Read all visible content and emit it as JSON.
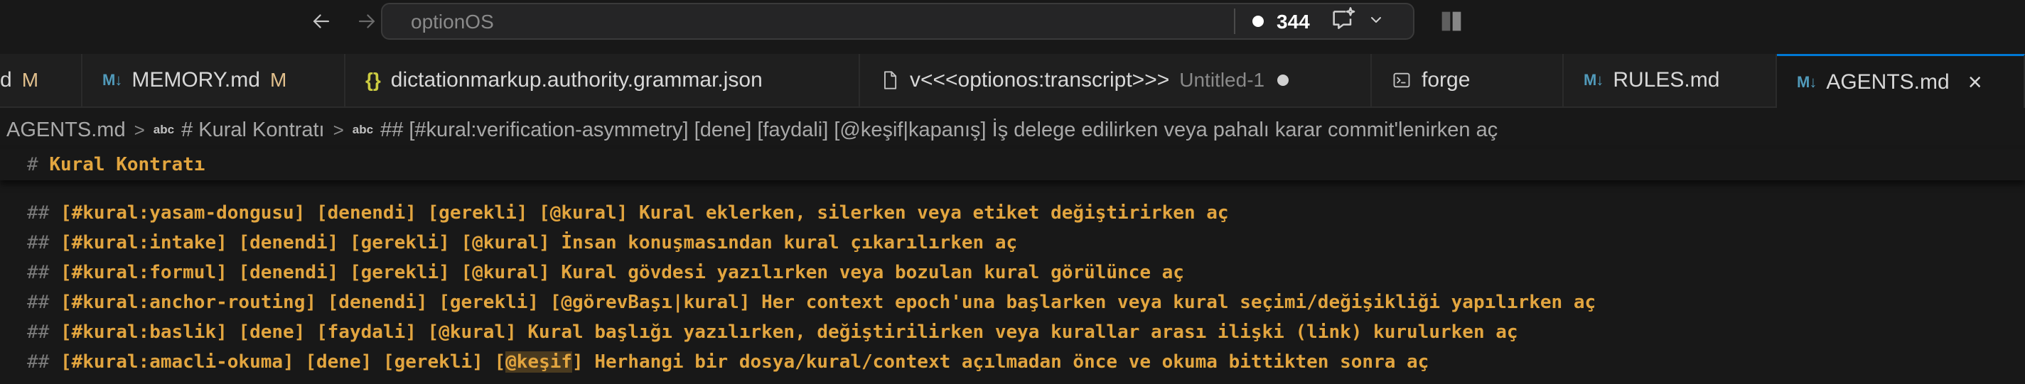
{
  "titlebar": {
    "search_text": "optionOS",
    "count": "344"
  },
  "tabs": [
    {
      "label": "d",
      "mark": "M"
    },
    {
      "label": "MEMORY.md",
      "mark": "M"
    },
    {
      "label": "dictationmarkup.authority.grammar.json"
    },
    {
      "label": "v<<<optionos:transcript>>>",
      "extra": "Untitled-1"
    },
    {
      "label": "forge"
    },
    {
      "label": "RULES.md"
    },
    {
      "label": "AGENTS.md"
    }
  ],
  "breadcrumb": {
    "file": "AGENTS.md",
    "section": "# Kural Kontratı",
    "subsection": "## [#kural:verification-asymmetry] [dene] [faydali] [@keşif|kapanış] İş delege edilirken veya pahalı karar commit'lenirken aç"
  },
  "editor": {
    "sticky": {
      "hash": "#",
      "text": "Kural Kontratı"
    },
    "lines": [
      {
        "hash": "##",
        "text": "[#kural:yasam-dongusu] [denendi] [gerekli] [@kural] Kural eklerken, silerken veya etiket değiştirirken aç"
      },
      {
        "hash": "##",
        "text": "[#kural:intake] [denendi] [gerekli] [@kural] İnsan konuşmasından kural çıkarılırken aç"
      },
      {
        "hash": "##",
        "text": "[#kural:formul] [denendi] [gerekli] [@kural] Kural gövdesi yazılırken veya bozulan kural görülünce aç"
      },
      {
        "hash": "##",
        "text": "[#kural:anchor-routing] [denendi] [gerekli] [@görevBaşı|kural] Her context epoch'una başlarken veya kural seçimi/değişikliği yapılırken aç"
      },
      {
        "hash": "##",
        "text": "[#kural:baslik] [dene] [faydali] [@kural] Kural başlığı yazılırken, değiştirilirken veya kurallar arası ilişki (link) kurulurken aç"
      },
      {
        "hash": "##",
        "pre": "[#kural:amacli-okuma] [dene] [gerekli] [",
        "highlight": "@keşif",
        "post": "] Herhangi bir dosya/kural/context açılmadan önce ve okuma bittikten sonra aç"
      }
    ]
  },
  "colors": {
    "background": "#181818",
    "heading": "#e2a53f",
    "accent": "#0078d4",
    "modified": "#e2c08d",
    "markdown_icon": "#519aba",
    "json_icon": "#cbcb41"
  }
}
